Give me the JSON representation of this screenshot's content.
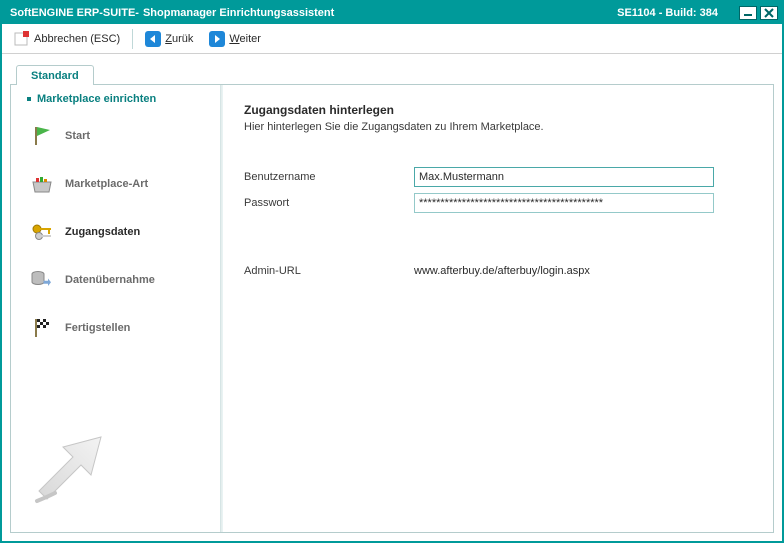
{
  "titlebar": {
    "appName": "SoftENGINE ERP-SUITE",
    "sep": " - ",
    "windowTitle": "Shopmanager Einrichtungsassistent",
    "build": "SE1104 - Build: 384"
  },
  "toolbar": {
    "cancel": "Abbrechen (ESC)",
    "backPrefix": "Z",
    "backRest": "urük",
    "nextPrefix": "W",
    "nextRest": "eiter"
  },
  "tabs": {
    "standard": "Standard"
  },
  "sidebar": {
    "heading": "Marketplace einrichten",
    "steps": {
      "start": "Start",
      "marketplaceType": "Marketplace-Art",
      "credentials": "Zugangsdaten",
      "dataImport": "Datenübernahme",
      "finish": "Fertigstellen"
    }
  },
  "main": {
    "heading": "Zugangsdaten hinterlegen",
    "sub": "Hier hinterlegen Sie die Zugangsdaten zu Ihrem Marketplace.",
    "labels": {
      "username": "Benutzername",
      "password": "Passwort",
      "adminUrl": "Admin-URL"
    },
    "values": {
      "username": "Max.Mustermann",
      "password": "*******************************************",
      "adminUrl": "www.afterbuy.de/afterbuy/login.aspx"
    }
  }
}
